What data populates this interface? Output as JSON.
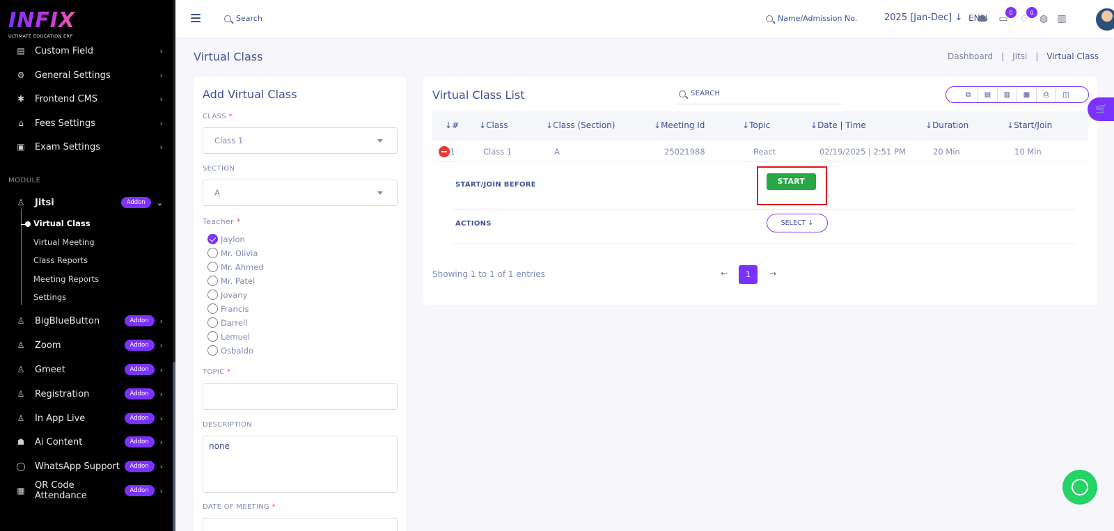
{
  "brand": {
    "name": "INFIX",
    "tagline": "ULTIMATE EDUCATION ERP"
  },
  "sidebar": {
    "items_top": [
      {
        "label": "Custom Field",
        "icon": "settings-icon"
      },
      {
        "label": "General Settings",
        "icon": "gears-icon"
      },
      {
        "label": "Frontend CMS",
        "icon": "gear-icon"
      },
      {
        "label": "Fees Settings",
        "icon": "bank-icon"
      },
      {
        "label": "Exam Settings",
        "icon": "exam-icon"
      }
    ],
    "section_label": "MODULE",
    "jitsi": {
      "label": "Jitsi",
      "badge": "Addon"
    },
    "jitsi_sub": [
      "Virtual Class",
      "Virtual Meeting",
      "Class Reports",
      "Meeting Reports",
      "Settings"
    ],
    "modules": [
      {
        "label": "BigBlueButton",
        "badge": "Addon"
      },
      {
        "label": "Zoom",
        "badge": "Addon"
      },
      {
        "label": "Gmeet",
        "badge": "Addon"
      },
      {
        "label": "Registration",
        "badge": "Addon"
      },
      {
        "label": "In App Live",
        "badge": "Addon"
      },
      {
        "label": "Ai Content",
        "badge": "Addon"
      },
      {
        "label": "WhatsApp Support",
        "badge": "Addon"
      },
      {
        "label": "QR Code Attendance",
        "badge": "Addon"
      }
    ]
  },
  "header": {
    "search_placeholder": "Search",
    "student_search": "Name/Admission No.",
    "year": "2025 [Jan-Dec]",
    "lang": "EN",
    "chat_count": "0",
    "notif_count": "0"
  },
  "page": {
    "title": "Virtual Class",
    "breadcrumb": [
      "Dashboard",
      "Jitsi",
      "Virtual Class"
    ]
  },
  "form": {
    "title": "Add Virtual Class",
    "class_label": "CLASS",
    "class_value": "Class 1",
    "section_label": "SECTION",
    "section_value": "A",
    "teacher_label": "Teacher",
    "teachers": [
      "Jaylon",
      "Mr. Olivia",
      "Mr. Ahmed",
      "Mr. Patel",
      "Jovany",
      "Francis",
      "Darrell",
      "Lemuel",
      "Osbaldo"
    ],
    "teacher_checked_index": 0,
    "topic_label": "TOPIC",
    "topic_value": "",
    "description_label": "DESCRIPTION",
    "description_value": "none",
    "date_label": "DATE OF MEETING",
    "required_mark": "*"
  },
  "list": {
    "title": "Virtual Class List",
    "search_placeholder": "SEARCH",
    "columns": [
      "#",
      "Class",
      "Class (Section)",
      "Meeting Id",
      "Topic",
      "Date | Time",
      "Duration",
      "Start/Join"
    ],
    "row": {
      "num": "1",
      "class": "Class 1",
      "section": "A",
      "meeting_id": "25021988",
      "topic": "React",
      "datetime": "02/19/2025 | 2:51 PM",
      "duration": "20 Min",
      "start_join": "10 Min"
    },
    "start_join_before_label": "START/JOIN BEFORE",
    "start_button": "START",
    "actions_label": "ACTIONS",
    "select_button": "SELECT",
    "showing": "Showing 1 to 1 of 1 entries",
    "current_page": "1"
  },
  "colors": {
    "accent": "#7c32ff",
    "start": "#28a745",
    "highlight": "#e01818"
  }
}
